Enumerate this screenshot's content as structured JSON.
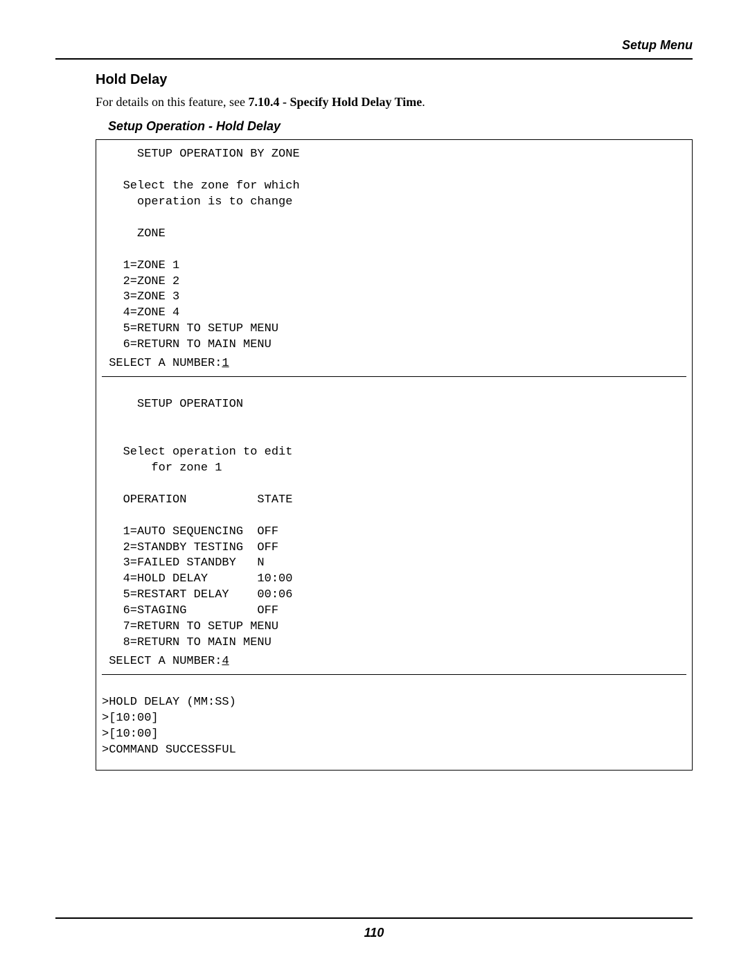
{
  "header": {
    "right_text": "Setup Menu"
  },
  "section": {
    "title": "Hold Delay",
    "intro_prefix": "For details on this feature, see ",
    "intro_bold": "7.10.4 - Specify Hold Delay Time",
    "intro_suffix": ".",
    "caption": "Setup Operation - Hold Delay"
  },
  "terminal": {
    "block1": "     SETUP OPERATION BY ZONE\n\n   Select the zone for which\n     operation is to change\n\n     ZONE\n\n   1=ZONE 1\n   2=ZONE 2\n   3=ZONE 3\n   4=ZONE 4\n   5=RETURN TO SETUP MENU\n   6=RETURN TO MAIN MENU\n",
    "prompt1_label": " SELECT A NUMBER:",
    "prompt1_value": "1",
    "block2": "\n     SETUP OPERATION\n\n\n   Select operation to edit\n       for zone 1\n\n   OPERATION          STATE\n\n   1=AUTO SEQUENCING  OFF\n   2=STANDBY TESTING  OFF\n   3=FAILED STANDBY   N\n   4=HOLD DELAY       10:00\n   5=RESTART DELAY    00:06\n   6=STAGING          OFF\n   7=RETURN TO SETUP MENU\n   8=RETURN TO MAIN MENU\n",
    "prompt2_label": " SELECT A NUMBER:",
    "prompt2_value": "4",
    "block3": "\n>HOLD DELAY (MM:SS)\n>[10:00]\n>[10:00]\n>COMMAND SUCCESSFUL"
  },
  "footer": {
    "page_number": "110"
  }
}
